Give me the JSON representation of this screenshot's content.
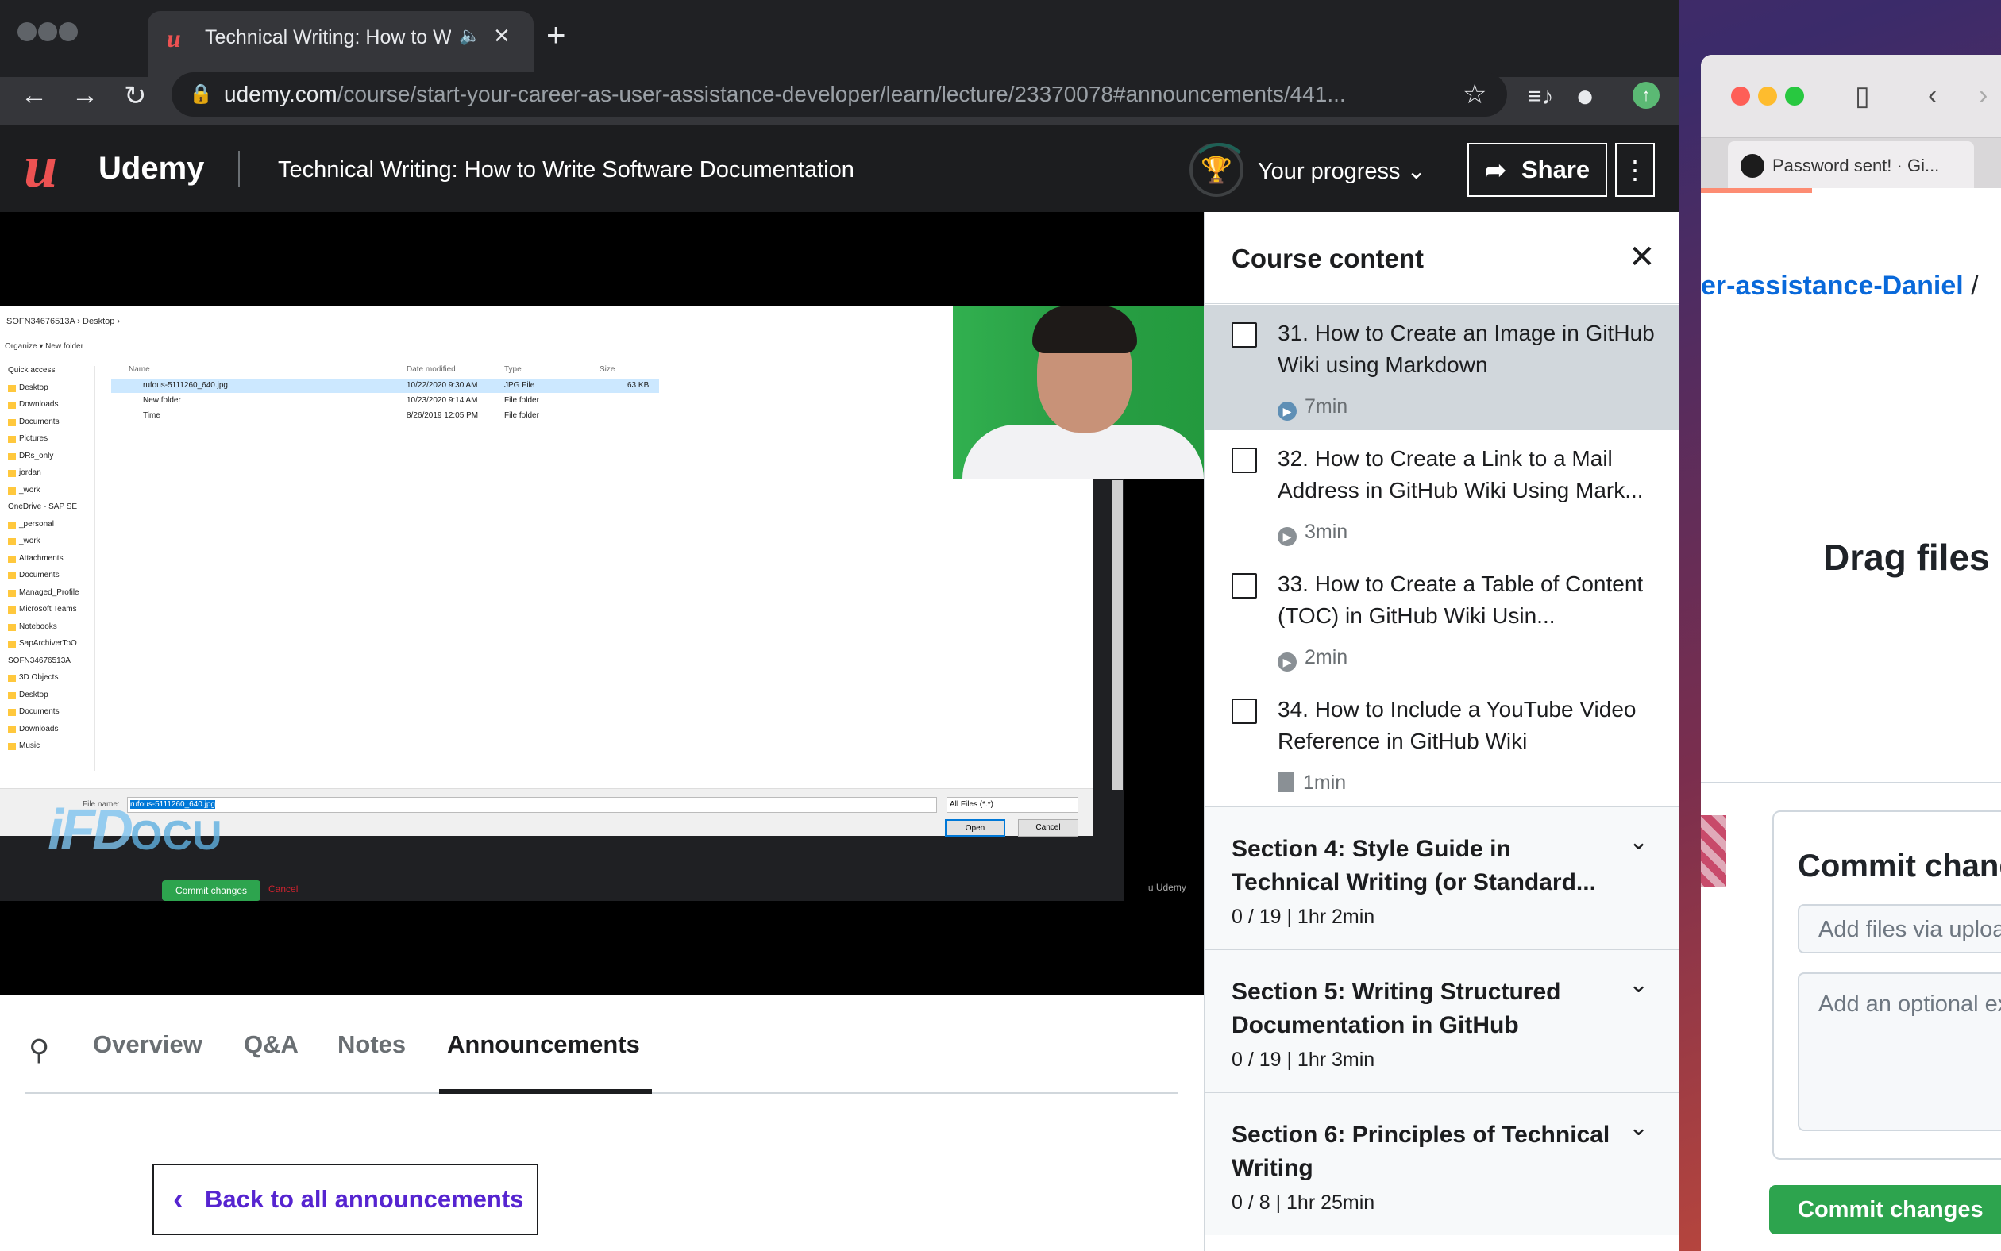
{
  "browser": {
    "tab_title": "Technical Writing: How to Write Software Documentation",
    "url_host": "udemy.com",
    "url_path": "/course/start-your-career-as-user-assistance-developer/learn/lecture/23370078#announcements/441...",
    "icons": [
      "back-icon",
      "forward-icon",
      "reload-icon",
      "lock-icon",
      "star-icon",
      "media-icon",
      "profile-icon",
      "update-icon"
    ]
  },
  "header": {
    "brand": "Udemy",
    "course_title": "Technical Writing: How to Write Software Documentation",
    "progress_label": "Your progress",
    "share_label": "Share"
  },
  "video": {
    "explorer": {
      "path": "SOFN34676513A  ›  Desktop  ›",
      "organize": "Organize ▾      New folder",
      "nav": [
        "Quick access",
        "Desktop",
        "Downloads",
        "Documents",
        "Pictures",
        "DRs_only",
        "jordan",
        "_work",
        "OneDrive - SAP SE",
        "_personal",
        "_work",
        "Attachments",
        "Documents",
        "Managed_Profile",
        "Microsoft Teams",
        "Notebooks",
        "SapArchiverToO",
        "SOFN34676513A",
        "3D Objects",
        "Desktop",
        "Documents",
        "Downloads",
        "Music"
      ],
      "columns": {
        "name": "Name",
        "date": "Date modified",
        "type": "Type",
        "size": "Size"
      },
      "files": [
        {
          "name": "rufous-5111260_640.jpg",
          "date": "10/22/2020 9:30 AM",
          "type": "JPG File",
          "size": "63 KB"
        },
        {
          "name": "New folder",
          "date": "10/23/2020 9:14 AM",
          "type": "File folder",
          "size": ""
        },
        {
          "name": "Time",
          "date": "8/26/2019 12:05 PM",
          "type": "File folder",
          "size": ""
        }
      ],
      "file_name_label": "File name:",
      "file_name_value": "rufous-5111260_640.jpg",
      "file_type": "All Files (*.*)",
      "open_label": "Open",
      "cancel_label": "Cancel"
    },
    "watermark_a": "iFD",
    "watermark_b": "OCU",
    "gh_commit": "Commit changes",
    "gh_cancel": "Cancel",
    "udemy_mark": "Udemy"
  },
  "tabs": {
    "items": [
      "Overview",
      "Q&A",
      "Notes",
      "Announcements"
    ],
    "active": "Announcements"
  },
  "announcements": {
    "back_label": "Back to all announcements"
  },
  "sidebar": {
    "title": "Course content",
    "lectures": [
      {
        "title": "31. How to Create an Image in GitHub Wiki using Markdown",
        "duration": "7min",
        "kind": "video",
        "current": true
      },
      {
        "title": "32. How to Create a Link to a Mail Address in GitHub Wiki Using Mark...",
        "duration": "3min",
        "kind": "video",
        "current": false
      },
      {
        "title": "33. How to Create a Table of Content (TOC) in GitHub Wiki Usin...",
        "duration": "2min",
        "kind": "video",
        "current": false
      },
      {
        "title": "34. How to Include a YouTube Video Reference in GitHub Wiki",
        "duration": "1min",
        "kind": "article",
        "current": false
      }
    ],
    "sections": [
      {
        "title": "Section 4: Style Guide in Technical Writing (or Standard...",
        "meta": "0 / 19 | 1hr 2min"
      },
      {
        "title": "Section 5: Writing Structured Documentation in GitHub",
        "meta": "0 / 19 | 1hr 3min"
      },
      {
        "title": "Section 6: Principles of Technical Writing",
        "meta": "0 / 8 | 1hr 25min"
      }
    ]
  },
  "safari": {
    "tab_title": "Password sent! · Gi...",
    "repo": "er-assistance-Daniel",
    "repo_sep": "/",
    "drag_text": "Drag files",
    "commit_title": "Commit chang",
    "add_files_placeholder": "Add files via uploa",
    "desc_placeholder": "Add an optional ex",
    "commit_button": "Commit changes"
  },
  "colors": {
    "brand": "#ec5252",
    "udemy_dark": "#1c1d1f",
    "purple": "#5624d0",
    "gh_green": "#2da44e",
    "gh_blue": "#0969da"
  }
}
